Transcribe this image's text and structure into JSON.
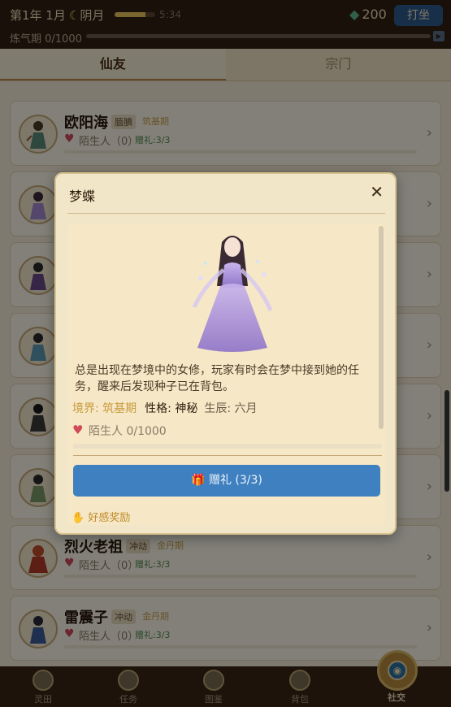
{
  "status": {
    "year": "第1年 1月",
    "moon_phase": "阴月",
    "clock": "5:34",
    "energy_fraction": 0.75,
    "spirit_stones": "200",
    "meditate_label": "打坐",
    "realm_label": "炼气期 0/1000",
    "realm_progress": 0.0
  },
  "tabs": [
    {
      "label": "仙友",
      "active": true
    },
    {
      "label": "宗门",
      "active": false
    }
  ],
  "friends": [
    {
      "name": "欧阳海",
      "trait": "腼腆",
      "realm": "筑基期",
      "relation": "陌生人（0）",
      "gifts": "赠礼:3/3"
    },
    {
      "name": "",
      "trait": "",
      "realm": "",
      "relation": "",
      "gifts": ""
    },
    {
      "name": "",
      "trait": "",
      "realm": "",
      "relation": "",
      "gifts": ""
    },
    {
      "name": "",
      "trait": "",
      "realm": "",
      "relation": "",
      "gifts": ""
    },
    {
      "name": "",
      "trait": "",
      "realm": "",
      "relation": "",
      "gifts": ""
    },
    {
      "name": "",
      "trait": "",
      "realm": "",
      "relation": "",
      "gifts": ""
    },
    {
      "name": "烈火老祖",
      "trait": "冲动",
      "realm": "金丹期",
      "relation": "陌生人（0）",
      "gifts": "赠礼:3/3"
    },
    {
      "name": "雷震子",
      "trait": "冲动",
      "realm": "金丹期",
      "relation": "陌生人（0）",
      "gifts": "赠礼:3/3"
    }
  ],
  "nav": [
    {
      "label": "灵田",
      "active": false
    },
    {
      "label": "任务",
      "active": false
    },
    {
      "label": "图鉴",
      "active": false
    },
    {
      "label": "背包",
      "active": false
    },
    {
      "label": "社交",
      "active": true
    }
  ],
  "dialog": {
    "title": "梦蝶",
    "close_glyph": "✕",
    "description": "总是出现在梦境中的女修，玩家有时会在梦中接到她的任务，醒来后发现种子已在背包。",
    "realm": "境界: 筑基期",
    "trait": "性格: 神秘",
    "birth": "生辰: 六月",
    "relation": "陌生人  0/1000",
    "affection_progress": 0.0,
    "gift_button": "赠礼 (3/3)",
    "reward_label": "好感奖励"
  },
  "icons": {
    "moon": "crescent-moon-icon",
    "stone": "spirit-stone-icon",
    "heart": "heart-icon",
    "gift": "gift-icon",
    "reward": "hand-reward-icon",
    "arrow": "chevron-right-icon",
    "close": "close-icon"
  },
  "colors": {
    "accent_blue": "#3f81c0",
    "heart_red": "#d04a5a",
    "realm_gold": "#c89a3c",
    "panel": "#f2e6c8"
  }
}
